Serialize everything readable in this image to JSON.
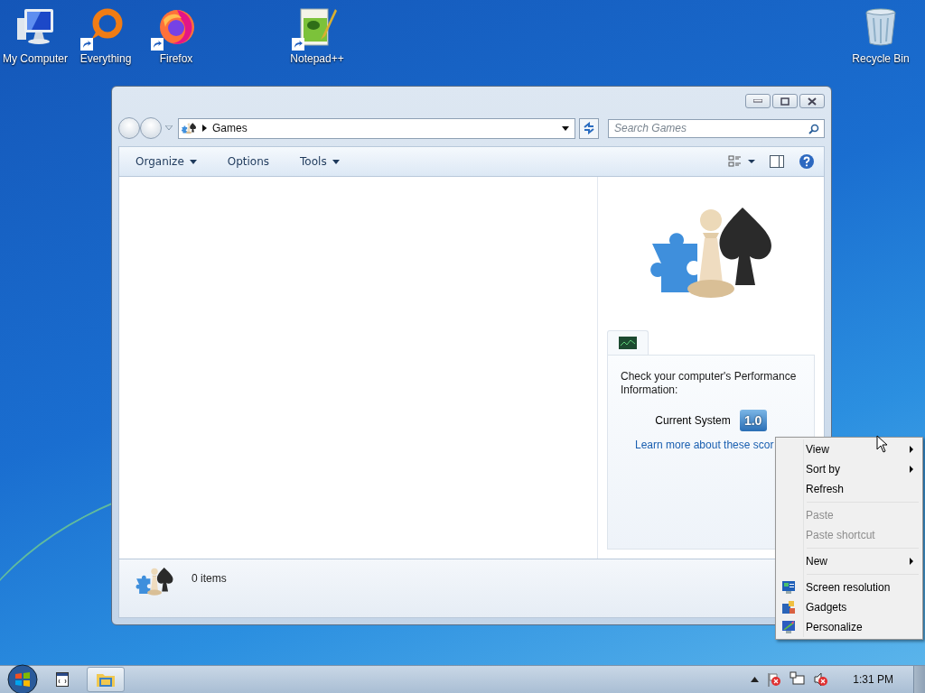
{
  "desktop_icons": [
    {
      "label": "My Computer",
      "kind": "computer",
      "shortcut": false
    },
    {
      "label": "Everything",
      "kind": "ring",
      "shortcut": true
    },
    {
      "label": "Firefox",
      "kind": "browser",
      "shortcut": true
    },
    {
      "label": "Notepad++",
      "kind": "notepad",
      "shortcut": true
    },
    {
      "label": "Recycle Bin",
      "kind": "bin",
      "shortcut": false
    }
  ],
  "window": {
    "address": "Games",
    "search": {
      "placeholder": "Search Games"
    },
    "toolbar": [
      {
        "label": "Organize",
        "dropdown": true
      },
      {
        "label": "Options",
        "dropdown": false
      },
      {
        "label": "Tools",
        "dropdown": true
      }
    ],
    "performance": {
      "heading": "Check your computer's Performance Information:",
      "label": "Current System",
      "score": "1.0",
      "link": "Learn more about these scor"
    },
    "status": "0 items"
  },
  "context_menu": [
    {
      "label": "View",
      "kind": "submenu",
      "disabled": false
    },
    {
      "label": "Sort by",
      "kind": "submenu",
      "disabled": false
    },
    {
      "label": "Refresh",
      "kind": "plain",
      "disabled": false
    },
    {
      "kind": "separator"
    },
    {
      "label": "Paste",
      "kind": "plain",
      "disabled": true
    },
    {
      "label": "Paste shortcut",
      "kind": "plain",
      "disabled": true
    },
    {
      "kind": "separator"
    },
    {
      "label": "New",
      "kind": "submenu",
      "disabled": false
    },
    {
      "kind": "separator"
    },
    {
      "label": "Screen resolution",
      "kind": "screen",
      "disabled": false
    },
    {
      "label": "Gadgets",
      "kind": "gadgets",
      "disabled": false
    },
    {
      "label": "Personalize",
      "kind": "personalize",
      "disabled": false
    }
  ],
  "taskbar": {
    "clock": "1:31 PM"
  }
}
